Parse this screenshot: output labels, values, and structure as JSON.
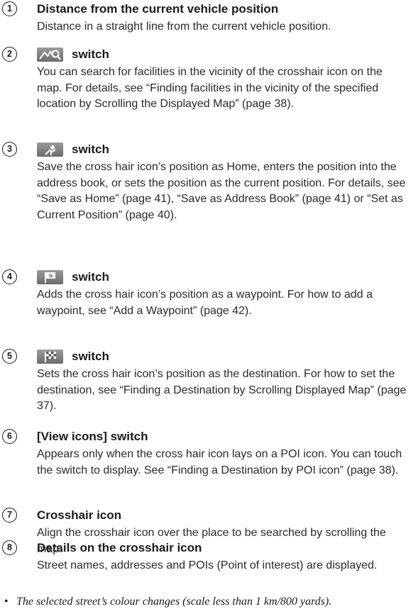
{
  "items": [
    {
      "number": "1",
      "title": "Distance from the current vehicle position",
      "body": "Distance in a straight line from the current vehicle position."
    },
    {
      "number": "2",
      "icon": "area-search-icon",
      "title": "switch",
      "body": "You can search for facilities in the vicinity of the crosshair icon on the map. For details, see “Finding facilities in the vicinity of the specified location by Scrolling the Displayed Map” (page 38)."
    },
    {
      "number": "3",
      "icon": "save-position-icon",
      "title": "switch",
      "body": "Save the cross hair icon’s position as Home, enters the position into the address book, or sets the position as the current position. For details, see “Save as Home” (page 41), “Save as Address Book” (page 41) or “Set as Current Position” (page 40)."
    },
    {
      "number": "4",
      "icon": "waypoint-flag-icon",
      "title": "switch",
      "body": "Adds the cross hair icon’s position as a waypoint. For how to add a waypoint, see “Add a Waypoint” (page 42)."
    },
    {
      "number": "5",
      "icon": "destination-flag-icon",
      "title": "switch",
      "body": "Sets the cross hair icon’s position as the destination. For how to set the destination, see “Finding a Destination by Scrolling Displayed Map” (page 37)."
    },
    {
      "number": "6",
      "title": "[View icons] switch",
      "body": "Appears only when the cross hair icon lays on a POI icon. You can touch the switch to display. See “Finding a Destination by POI icon” (page 38)."
    },
    {
      "number": "7",
      "title": "Crosshair icon",
      "body": "Align the crosshair icon over the place to be searched by scrolling the map."
    },
    {
      "number": "8",
      "title": "Details on the crosshair icon",
      "body": "Street names, addresses and POIs (Point of interest) are displayed."
    }
  ],
  "note": {
    "bullet": "•",
    "text": "The selected street’s colour changes (scale less than 1 km/800 yards)."
  }
}
